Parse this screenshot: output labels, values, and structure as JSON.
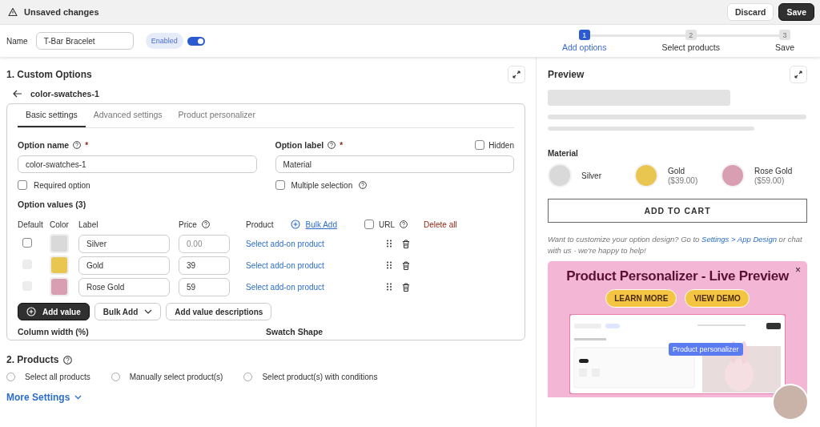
{
  "top_bar": {
    "title": "Unsaved changes",
    "buttons": [
      {
        "label": "Discard",
        "kind": "secondary"
      },
      {
        "label": "Save",
        "kind": "primary"
      }
    ]
  },
  "header": {
    "name_label": "Name",
    "name_value": "T-Bar Bracelet",
    "status_badge": "Enabled",
    "enabled": true,
    "steps": [
      {
        "number": "1",
        "label": "Add options",
        "selected": true
      },
      {
        "number": "2",
        "label": "Select products",
        "selected": false
      },
      {
        "number": "3",
        "label": "Save",
        "selected": false
      }
    ]
  },
  "custom_options": {
    "title": "1. Custom Options",
    "back_label": "color-swatches-1",
    "tabs": [
      {
        "label": "Basic settings",
        "selected": true
      },
      {
        "label": "Advanced settings",
        "selected": false
      },
      {
        "label": "Product personalizer",
        "selected": false
      }
    ],
    "option_name": {
      "label": "Option name",
      "required_mark": "*",
      "value": "color-swatches-1"
    },
    "option_label": {
      "label": "Option label",
      "required_mark": "*",
      "value": "Material",
      "hidden_label": "Hidden",
      "hidden": false
    },
    "required_option": {
      "label": "Required option",
      "checked": false
    },
    "multiple_selection": {
      "label": "Multiple selection",
      "checked": false
    },
    "values_title": "Option values (3)",
    "columns": [
      "Default",
      "Color",
      "Label",
      "Price",
      "Product"
    ],
    "bulk_add_link": "Bulk Add",
    "url_label": "URL",
    "url_checked": false,
    "delete_all": "Delete all",
    "rows": [
      {
        "default": false,
        "disabled": false,
        "color": "#d9d9d9",
        "label": "Silver",
        "price_placeholder": "0.00",
        "product_link": "Select add-on product"
      },
      {
        "disabled": true,
        "color": "#e8c64f",
        "label": "Gold",
        "price": "39",
        "product_link": "Select add-on product"
      },
      {
        "disabled": true,
        "color": "#d89fb3",
        "label": "Rose Gold",
        "price": "59",
        "product_link": "Select add-on product"
      }
    ],
    "add_value": "Add value",
    "bulk_add_button": "Bulk Add",
    "add_descriptions": "Add value descriptions",
    "more_fields": [
      "Column width (%)",
      "Swatch Shape"
    ]
  },
  "products": {
    "title": "2. Products",
    "choices": [
      {
        "label": "Select all products",
        "selected": false
      },
      {
        "label": "Manually select product(s)",
        "selected": false
      },
      {
        "label": "Select product(s) with conditions",
        "selected": false
      }
    ],
    "more_settings": "More Settings"
  },
  "preview": {
    "title": "Preview",
    "option_title": "Material",
    "swatches": [
      {
        "name": "Silver",
        "color": "#d9d9d9"
      },
      {
        "name": "Gold",
        "price": "($39.00)",
        "color": "#e8c64f"
      },
      {
        "name": "Rose Gold",
        "price": "($59.00)",
        "color": "#d89fb3"
      }
    ],
    "add_to_cart": "ADD TO CART",
    "help_text": "Want to customize your option design? Go to",
    "help_link": "Settings > App Design",
    "help_text_end": "or chat with us - we're happy to help!",
    "banner": {
      "title": "Product Personalizer - Live Preview",
      "close": "×",
      "buttons": [
        "LEARN MORE",
        "VIEW DEMO"
      ],
      "tag": "Product personalizer"
    }
  }
}
